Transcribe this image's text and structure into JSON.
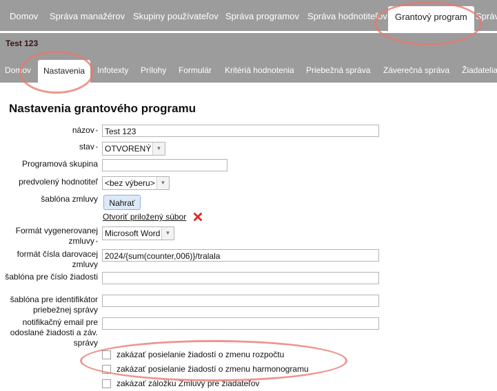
{
  "top_nav": {
    "items": [
      "Domov",
      "Správa manažérov",
      "Skupiny používateľov",
      "Správa programov",
      "Správa hodnotiteľov",
      "Grantový program",
      "Správ"
    ],
    "active": "Grantový program"
  },
  "program_title": "Test 123",
  "sub_nav": {
    "items": [
      "Domov",
      "Nastavenia",
      "Infotexty",
      "Prílohy",
      "Formulár",
      "Kritériá hodnotenia",
      "Priebežná správa",
      "Záverečná správa",
      "Žiadatelia"
    ],
    "active": "Nastavenia"
  },
  "heading": "Nastavenia grantového programu",
  "form": {
    "nazov": {
      "label": "názov",
      "value": "Test 123"
    },
    "stav": {
      "label": "stav",
      "value": "OTVORENÝ"
    },
    "programova_skupina": {
      "label": "Programová skupina",
      "value": ""
    },
    "predvoleny_hodnotitel": {
      "label": "predvolený hodnotiteľ",
      "value": "<bez výberu>"
    },
    "sablona_zmluvy": {
      "label": "šablóna zmluvy",
      "upload_label": "Nahrať",
      "open_link": "Otvoriť priložený súbor"
    },
    "format_zmluvy": {
      "label": "Formát vygenerovanej zmluvy",
      "value": "Microsoft Word"
    },
    "format_cisla": {
      "label": "formát čísla darovacej zmluvy",
      "value": "2024/{sum(counter,006)}/tralala"
    },
    "sablona_cislo": {
      "label": "šablóna pre číslo žiadosti",
      "value": ""
    },
    "sablona_identifikator": {
      "label": "šablóna pre identifikátor priebežnej správy",
      "value": ""
    },
    "notifikacny_email": {
      "label": "notifikačný email pre odoslané žiadosti a záv. správy",
      "value": ""
    },
    "checkboxes": [
      {
        "label": "zakázať posielanie žiadostí o zmenu rozpočtu",
        "checked": false
      },
      {
        "label": "zakázať posielanie žiadostí o zmenu harmonogramu",
        "checked": false
      },
      {
        "label": "zakázať záložku Zmluvy pre žiadateľov",
        "checked": false
      }
    ]
  },
  "colors": {
    "nav_bg": "#9c9c9c",
    "highlight": "#e8786e",
    "delete_icon": "#e02b2b",
    "button_bg": "#dde9f7"
  },
  "icons": {
    "delete": "red-x-icon",
    "dropdown": "chevron-down-icon"
  }
}
